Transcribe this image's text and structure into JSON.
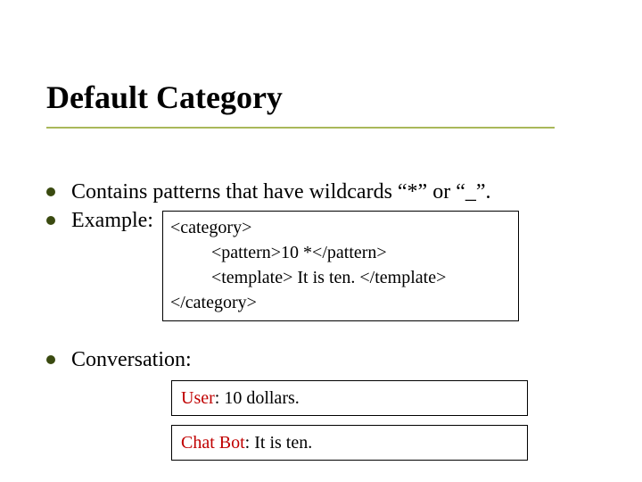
{
  "title": "Default Category",
  "bullets": {
    "b1": "Contains patterns that have wildcards “*” or “_”.",
    "b2_label": "Example:",
    "b3_label": "Conversation:"
  },
  "code": {
    "l1": "<category>",
    "l2": "<pattern>10 *</pattern>",
    "l3": "<template> It is ten. </template>",
    "l4": "</category>"
  },
  "conversation": {
    "user_prefix": "User",
    "user_line": ": 10 dollars.",
    "bot_prefix": "Chat Bot",
    "bot_line": ": It is ten."
  }
}
